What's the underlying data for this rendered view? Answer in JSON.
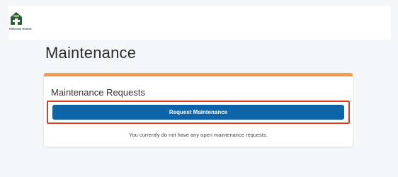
{
  "header": {
    "logo_text": "Hillbrook Homes",
    "brand_color": "#2f5d3a"
  },
  "page": {
    "title": "Maintenance"
  },
  "maintenance_card": {
    "title": "Maintenance Requests",
    "request_button_label": "Request Maintenance",
    "empty_message": "You currently do not have any open maintenance requests.",
    "accent_color": "#f0a04b",
    "button_color": "#0e64a8",
    "highlight_color": "#e23b1f"
  }
}
